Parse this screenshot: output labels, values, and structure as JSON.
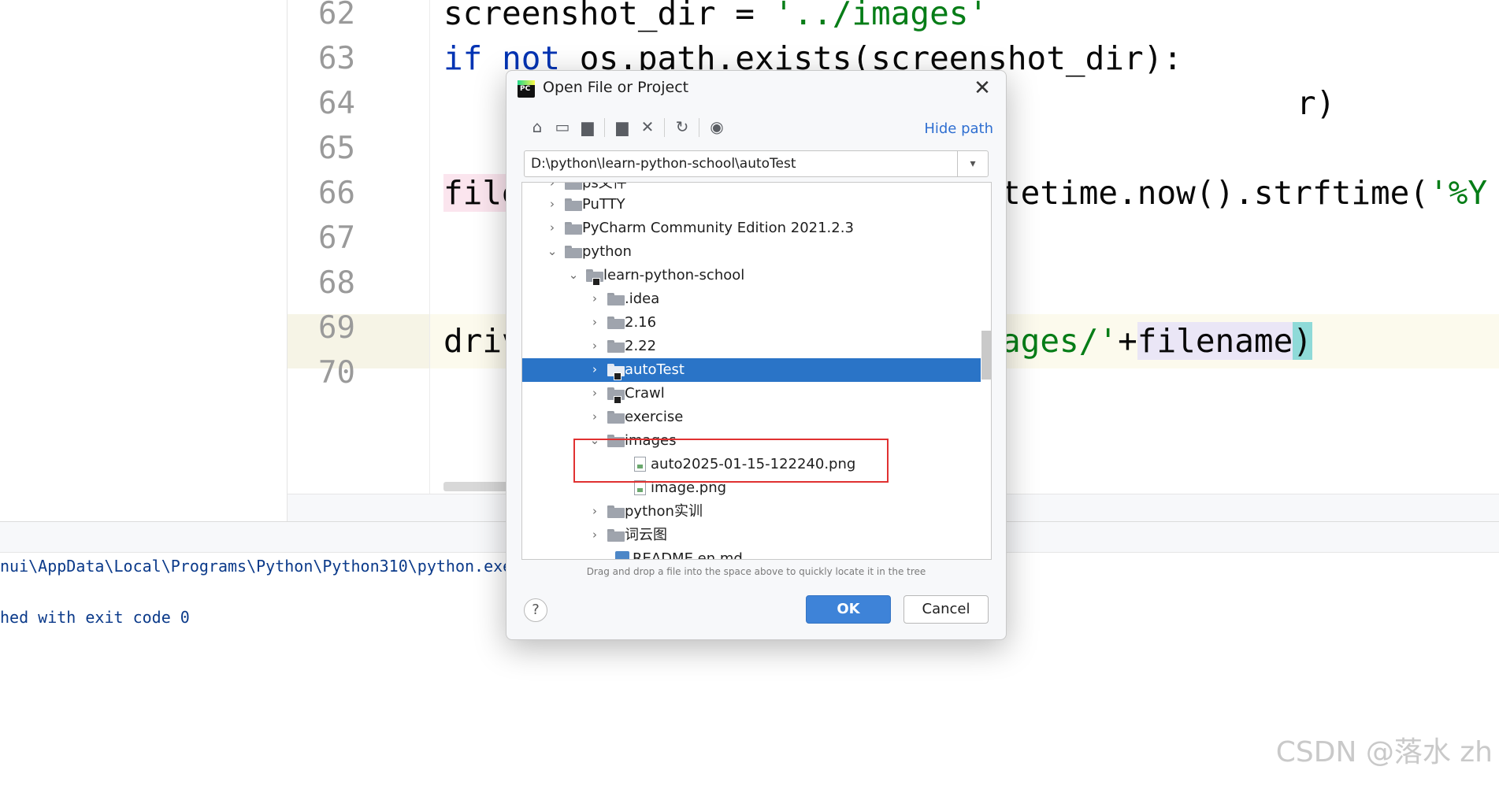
{
  "editor": {
    "line_numbers": [
      "62",
      "63",
      "64",
      "65",
      "66",
      "67",
      "68",
      "69",
      "70"
    ],
    "code": {
      "l62_a": "screenshot_dir = ",
      "l62_b": "'../images'",
      "l63_kw": "if",
      "l63_kw2": "not",
      "l63_rest": " os.path.exists(screenshot_dir):",
      "l64_tail": "r)",
      "l66_a": "file",
      "l66_b": "tetime.now().strftime(",
      "l66_c": "'%Y",
      "l68_a": "driv",
      "l68_b": "ages/'",
      "l68_c": "+",
      "l68_d": "filename",
      "l68_e": ")"
    }
  },
  "console": {
    "line1": "nui\\AppData\\Local\\Programs\\Python\\Python310\\python.exe",
    "line2": "hed with exit code 0"
  },
  "dialog": {
    "title": "Open File or Project",
    "app_icon_text": "PC",
    "close": "✕",
    "hide_path": "Hide path",
    "path_value": "D:\\python\\learn-python-school\\autoTest",
    "tree": [
      {
        "label": "ps文件",
        "arrow": "›",
        "icon": "folder"
      },
      {
        "label": "PuTTY",
        "arrow": "›",
        "icon": "folder"
      },
      {
        "label": "PyCharm Community Edition 2021.2.3",
        "arrow": "›",
        "icon": "folder"
      },
      {
        "label": "python",
        "arrow": "⌄",
        "icon": "folder"
      },
      {
        "label": "learn-python-school",
        "arrow": "⌄",
        "icon": "folder-module"
      },
      {
        "label": ".idea",
        "arrow": "›",
        "icon": "folder"
      },
      {
        "label": "2.16",
        "arrow": "›",
        "icon": "folder"
      },
      {
        "label": "2.22",
        "arrow": "›",
        "icon": "folder"
      },
      {
        "label": "autoTest",
        "arrow": "›",
        "icon": "folder-module",
        "selected": true
      },
      {
        "label": "Crawl",
        "arrow": "›",
        "icon": "folder-module"
      },
      {
        "label": "exercise",
        "arrow": "›",
        "icon": "folder"
      },
      {
        "label": "images",
        "arrow": "⌄",
        "icon": "folder"
      },
      {
        "label": "auto2025-01-15-122240.png",
        "arrow": "",
        "icon": "image-file"
      },
      {
        "label": "image.png",
        "arrow": "",
        "icon": "image-file"
      },
      {
        "label": "python实训",
        "arrow": "›",
        "icon": "folder"
      },
      {
        "label": "词云图",
        "arrow": "›",
        "icon": "folder"
      },
      {
        "label": "README.en.md",
        "arrow": "",
        "icon": "markdown-file"
      }
    ],
    "hint": "Drag and drop a file into the space above to quickly locate it in the tree",
    "help": "?",
    "ok": "OK",
    "cancel": "Cancel"
  },
  "watermark": "CSDN @落水 zh"
}
